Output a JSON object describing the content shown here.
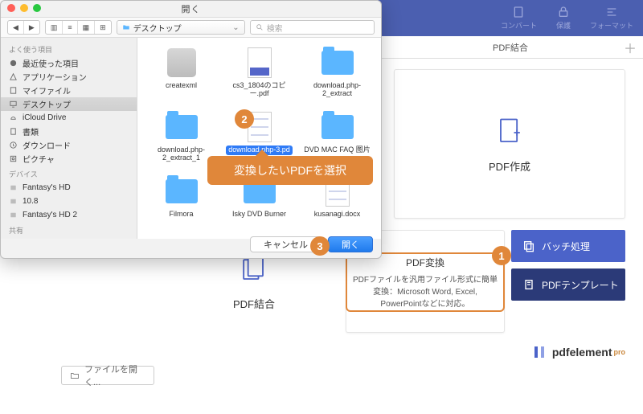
{
  "bg": {
    "toolbar": {
      "convert": "コンバート",
      "protect": "保護",
      "format": "フォーマット"
    },
    "subbar": {
      "title": "PDF結合"
    },
    "cards": {
      "create": "PDF作成",
      "convert_title": "PDF変換",
      "convert_desc": "PDFファイルを汎用ファイル形式に簡単変換：Microsoft Word, Excel, PowerPointなどに対応。",
      "merge": "PDF結合"
    },
    "side": {
      "batch": "バッチ処理",
      "template": "PDFテンプレート"
    },
    "brand": {
      "name": "pdfelement",
      "suffix": "pro"
    },
    "openfile": "ファイルを開く..."
  },
  "dlg": {
    "title": "開く",
    "path_label": "デスクトップ",
    "search_placeholder": "検索",
    "sidebar": {
      "h_fav": "よく使う項目",
      "fav": [
        "最近使った項目",
        "アプリケーション",
        "マイファイル",
        "デスクトップ",
        "iCloud Drive",
        "書類",
        "ダウンロード",
        "ピクチャ"
      ],
      "h_dev": "デバイス",
      "dev": [
        "Fantasy's HD",
        "10.8",
        "Fantasy's HD 2"
      ],
      "h_share": "共有"
    },
    "files": [
      "createxml",
      "cs3_1804のコピー.pdf",
      "download.php-2_extract",
      "download.php-2_extract_1",
      "download.php-3.pd",
      "DVD MAC FAQ 图片",
      "Filmora",
      "Isky DVD Burner",
      "kusanagi.docx"
    ],
    "buttons": {
      "cancel": "キャンセル",
      "open": "開く"
    }
  },
  "callouts": {
    "step1": "1",
    "step2": "2",
    "step3": "3",
    "select_pdf": "変換したいPDFを選択"
  }
}
